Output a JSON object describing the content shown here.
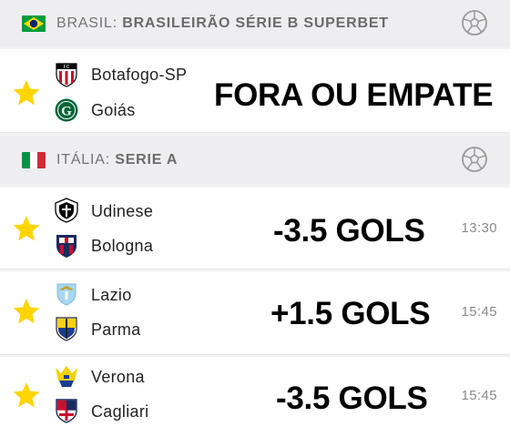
{
  "leagues": [
    {
      "country": "BRASIL",
      "name": "BRASILEIRÃO SÉRIE B SUPERBET",
      "flag": "brazil-flag",
      "sport_icon": "soccer-ball-icon",
      "matches": [
        {
          "home": "Botafogo-SP",
          "away": "Goiás",
          "tip": "FORA OU EMPATE",
          "time": ""
        }
      ]
    },
    {
      "country": "ITÁLIA",
      "name": "SERIE A",
      "flag": "italy-flag",
      "sport_icon": "soccer-ball-icon",
      "matches": [
        {
          "home": "Udinese",
          "away": "Bologna",
          "tip": "-3.5 GOLS",
          "time": "13:30"
        },
        {
          "home": "Lazio",
          "away": "Parma",
          "tip": "+1.5 GOLS",
          "time": "15:45"
        },
        {
          "home": "Verona",
          "away": "Cagliari",
          "tip": "-3.5 GOLS",
          "time": "15:45"
        }
      ]
    }
  ],
  "colors": {
    "favorite_star": "#ffd500",
    "header_bg": "#eeeef0",
    "row_bg": "#ffffff"
  }
}
